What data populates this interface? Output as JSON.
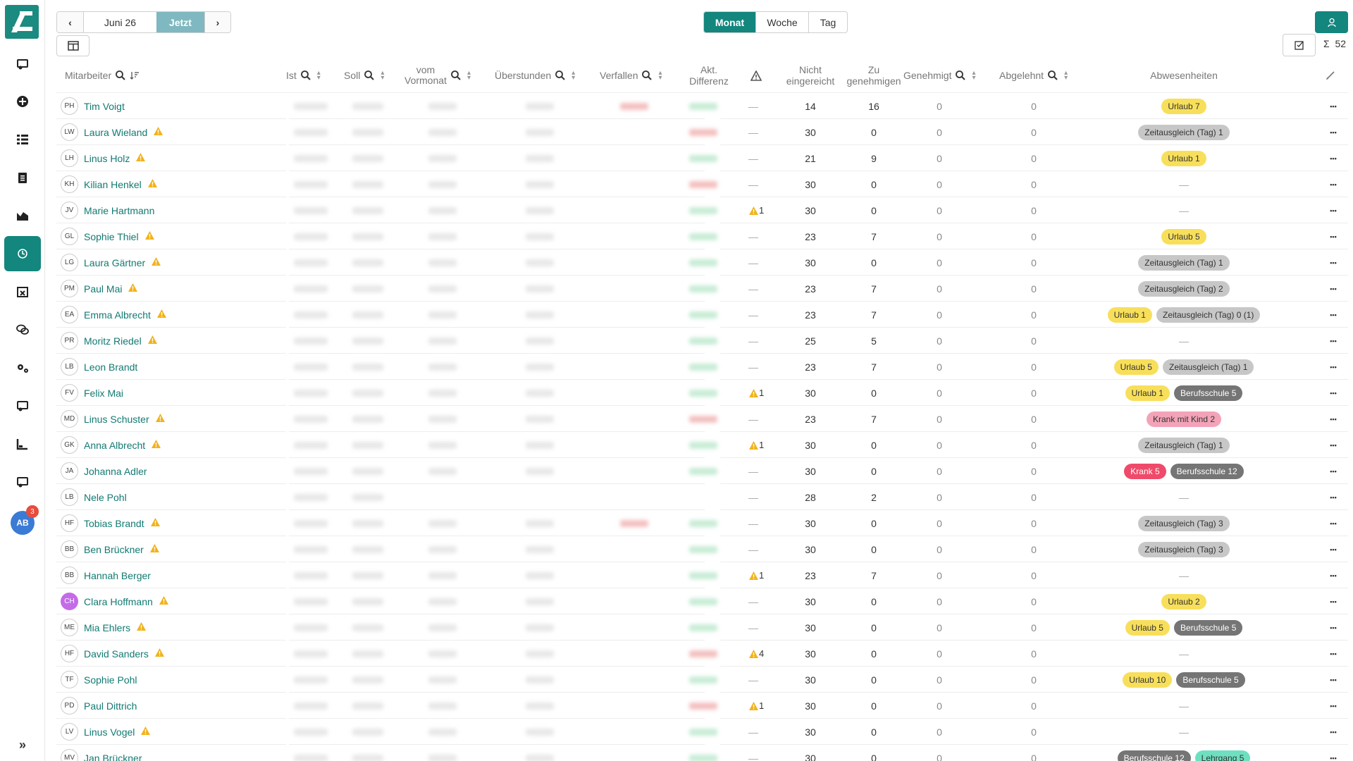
{
  "nav": {
    "prev_label": "‹",
    "month": "Juni 26",
    "now_label": "Jetzt",
    "next_label": "›"
  },
  "view": {
    "month": "Monat",
    "week": "Woche",
    "day": "Tag",
    "selected": "Monat"
  },
  "sum_label": "Σ",
  "sum_value": "52",
  "sidebar_badge": "3",
  "avatar_initials": "AB",
  "colors": {
    "accent": "#13867e",
    "name": "#127a72"
  },
  "headers": {
    "mitarbeiter": "Mitarbeiter",
    "ist": "Ist",
    "soll": "Soll",
    "vom": "vom",
    "vormonat": "Vormonat",
    "ueberstunden": "Überstunden",
    "verfallen": "Verfallen",
    "akt": "Akt.",
    "differenz": "Differenz",
    "nicht": "Nicht",
    "eingereicht": "eingereicht",
    "zu": "Zu",
    "genehmigen": "genehmigen",
    "genehmigt": "Genehmigt",
    "abgelehnt": "Abgelehnt",
    "abwesenheiten": "Abwesenheiten"
  },
  "rows": [
    {
      "initials": "PH",
      "name": "Tim Voigt",
      "warn": false,
      "status": "—",
      "nicht": "14",
      "zu": "16",
      "gen": "0",
      "abg": "0",
      "absences": [
        {
          "label": "Urlaub 7",
          "color": "yellow"
        }
      ],
      "diff": "green",
      "verf": true
    },
    {
      "initials": "LW",
      "name": "Laura Wieland",
      "warn": true,
      "status": "—",
      "nicht": "30",
      "zu": "0",
      "gen": "0",
      "abg": "0",
      "absences": [
        {
          "label": "Zeitausgleich (Tag) 1",
          "color": "grey"
        }
      ],
      "diff": "red",
      "verf": false
    },
    {
      "initials": "LH",
      "name": "Linus Holz",
      "warn": true,
      "status": "—",
      "nicht": "21",
      "zu": "9",
      "gen": "0",
      "abg": "0",
      "absences": [
        {
          "label": "Urlaub 1",
          "color": "yellow"
        }
      ],
      "diff": "green",
      "verf": false
    },
    {
      "initials": "KH",
      "name": "Kilian Henkel",
      "warn": true,
      "status": "—",
      "nicht": "30",
      "zu": "0",
      "gen": "0",
      "abg": "0",
      "absences": [],
      "diff": "red",
      "verf": false
    },
    {
      "initials": "JV",
      "name": "Marie Hartmann",
      "warn": false,
      "status": "1",
      "nicht": "30",
      "zu": "0",
      "gen": "0",
      "abg": "0",
      "absences": [],
      "diff": "green",
      "verf": false
    },
    {
      "initials": "GL",
      "name": "Sophie Thiel",
      "warn": true,
      "status": "—",
      "nicht": "23",
      "zu": "7",
      "gen": "0",
      "abg": "0",
      "absences": [
        {
          "label": "Urlaub 5",
          "color": "yellow"
        }
      ],
      "diff": "green",
      "verf": false
    },
    {
      "initials": "LG",
      "name": "Laura Gärtner",
      "warn": true,
      "status": "—",
      "nicht": "30",
      "zu": "0",
      "gen": "0",
      "abg": "0",
      "absences": [
        {
          "label": "Zeitausgleich (Tag) 1",
          "color": "grey"
        }
      ],
      "diff": "green",
      "verf": false
    },
    {
      "initials": "PM",
      "name": "Paul Mai",
      "warn": true,
      "status": "—",
      "nicht": "23",
      "zu": "7",
      "gen": "0",
      "abg": "0",
      "absences": [
        {
          "label": "Zeitausgleich (Tag) 2",
          "color": "grey"
        }
      ],
      "diff": "green",
      "verf": false
    },
    {
      "initials": "EA",
      "name": "Emma Albrecht",
      "warn": true,
      "status": "—",
      "nicht": "23",
      "zu": "7",
      "gen": "0",
      "abg": "0",
      "absences": [
        {
          "label": "Urlaub 1",
          "color": "yellow"
        },
        {
          "label": "Zeitausgleich (Tag) 0 (1)",
          "color": "grey"
        }
      ],
      "diff": "green",
      "verf": false
    },
    {
      "initials": "PR",
      "name": "Moritz Riedel",
      "warn": true,
      "status": "—",
      "nicht": "25",
      "zu": "5",
      "gen": "0",
      "abg": "0",
      "absences": [],
      "diff": "green",
      "verf": false
    },
    {
      "initials": "LB",
      "name": "Leon Brandt",
      "warn": false,
      "status": "—",
      "nicht": "23",
      "zu": "7",
      "gen": "0",
      "abg": "0",
      "absences": [
        {
          "label": "Urlaub 5",
          "color": "yellow"
        },
        {
          "label": "Zeitausgleich (Tag) 1",
          "color": "grey"
        }
      ],
      "diff": "green",
      "verf": false
    },
    {
      "initials": "FV",
      "name": "Felix Mai",
      "warn": false,
      "status": "1",
      "nicht": "30",
      "zu": "0",
      "gen": "0",
      "abg": "0",
      "absences": [
        {
          "label": "Urlaub 1",
          "color": "yellow"
        },
        {
          "label": "Berufsschule 5",
          "color": "darkgrey"
        }
      ],
      "diff": "green",
      "verf": false
    },
    {
      "initials": "MD",
      "name": "Linus Schuster",
      "warn": true,
      "status": "—",
      "nicht": "23",
      "zu": "7",
      "gen": "0",
      "abg": "0",
      "absences": [
        {
          "label": "Krank mit Kind 2",
          "color": "pink"
        }
      ],
      "diff": "red",
      "verf": false
    },
    {
      "initials": "GK",
      "name": "Anna Albrecht",
      "warn": true,
      "status": "1",
      "nicht": "30",
      "zu": "0",
      "gen": "0",
      "abg": "0",
      "absences": [
        {
          "label": "Zeitausgleich (Tag) 1",
          "color": "grey"
        }
      ],
      "diff": "green",
      "verf": false
    },
    {
      "initials": "JA",
      "name": "Johanna Adler",
      "warn": false,
      "status": "—",
      "nicht": "30",
      "zu": "0",
      "gen": "0",
      "abg": "0",
      "absences": [
        {
          "label": "Krank 5",
          "color": "red"
        },
        {
          "label": "Berufsschule 12",
          "color": "darkgrey"
        }
      ],
      "diff": "green",
      "verf": false
    },
    {
      "initials": "LB",
      "name": "Nele Pohl",
      "warn": false,
      "status": "—",
      "nicht": "28",
      "zu": "2",
      "gen": "0",
      "abg": "0",
      "absences": [],
      "diff": "none",
      "verf": false
    },
    {
      "initials": "HF",
      "name": "Tobias Brandt",
      "warn": true,
      "status": "—",
      "nicht": "30",
      "zu": "0",
      "gen": "0",
      "abg": "0",
      "absences": [
        {
          "label": "Zeitausgleich (Tag) 3",
          "color": "grey"
        }
      ],
      "diff": "green",
      "verf": true
    },
    {
      "initials": "BB",
      "name": "Ben Brückner",
      "warn": true,
      "status": "—",
      "nicht": "30",
      "zu": "0",
      "gen": "0",
      "abg": "0",
      "absences": [
        {
          "label": "Zeitausgleich (Tag) 3",
          "color": "grey"
        }
      ],
      "diff": "green",
      "verf": false
    },
    {
      "initials": "BB",
      "name": "Hannah Berger",
      "warn": false,
      "status": "1",
      "nicht": "23",
      "zu": "7",
      "gen": "0",
      "abg": "0",
      "absences": [],
      "diff": "green",
      "verf": false
    },
    {
      "initials": "CH",
      "name": "Clara Hoffmann",
      "warn": true,
      "status": "—",
      "nicht": "30",
      "zu": "0",
      "gen": "0",
      "abg": "0",
      "absences": [
        {
          "label": "Urlaub 2",
          "color": "yellow"
        }
      ],
      "diff": "green",
      "verf": false,
      "purple": true
    },
    {
      "initials": "ME",
      "name": "Mia Ehlers",
      "warn": true,
      "status": "—",
      "nicht": "30",
      "zu": "0",
      "gen": "0",
      "abg": "0",
      "absences": [
        {
          "label": "Urlaub 5",
          "color": "yellow"
        },
        {
          "label": "Berufsschule 5",
          "color": "darkgrey"
        }
      ],
      "diff": "green",
      "verf": false
    },
    {
      "initials": "HF",
      "name": "David Sanders",
      "warn": true,
      "status": "4",
      "nicht": "30",
      "zu": "0",
      "gen": "0",
      "abg": "0",
      "absences": [],
      "diff": "red",
      "verf": false
    },
    {
      "initials": "TF",
      "name": "Sophie Pohl",
      "warn": false,
      "status": "—",
      "nicht": "30",
      "zu": "0",
      "gen": "0",
      "abg": "0",
      "absences": [
        {
          "label": "Urlaub 10",
          "color": "yellow"
        },
        {
          "label": "Berufsschule 5",
          "color": "darkgrey"
        }
      ],
      "diff": "green",
      "verf": false
    },
    {
      "initials": "PD",
      "name": "Paul Dittrich",
      "warn": false,
      "status": "1",
      "nicht": "30",
      "zu": "0",
      "gen": "0",
      "abg": "0",
      "absences": [],
      "diff": "red",
      "verf": false
    },
    {
      "initials": "LV",
      "name": "Linus Vogel",
      "warn": true,
      "status": "—",
      "nicht": "30",
      "zu": "0",
      "gen": "0",
      "abg": "0",
      "absences": [],
      "diff": "green",
      "verf": false
    },
    {
      "initials": "MV",
      "name": "Jan Brückner",
      "warn": false,
      "status": "—",
      "nicht": "30",
      "zu": "0",
      "gen": "0",
      "abg": "0",
      "absences": [
        {
          "label": "Berufsschule 12",
          "color": "darkgrey"
        },
        {
          "label": "Lehrgang 5",
          "color": "teal"
        }
      ],
      "diff": "green",
      "verf": false
    }
  ]
}
